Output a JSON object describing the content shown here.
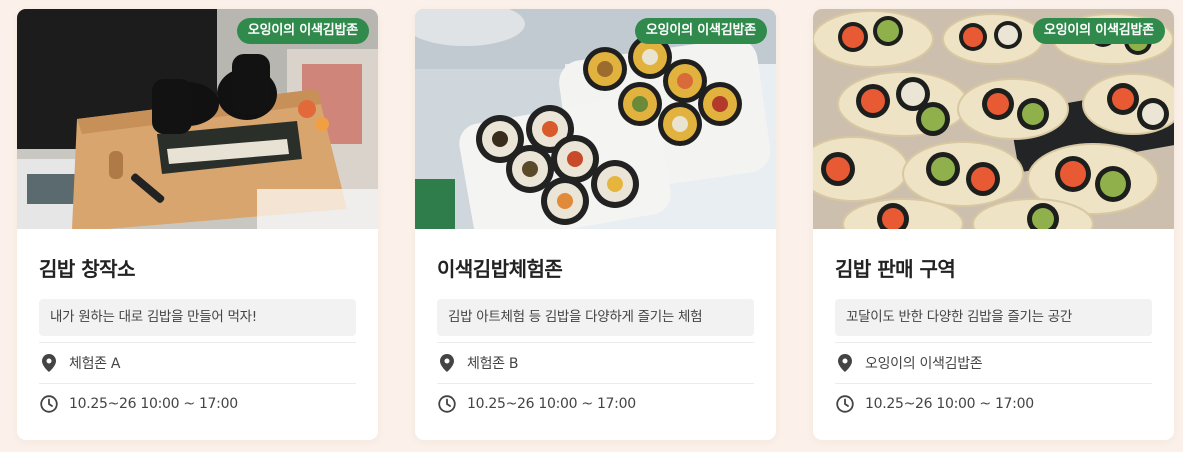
{
  "cards": [
    {
      "badge": "오잉이의 이색김밥존",
      "title": "김밥 창작소",
      "description": "내가 원하는 대로 김밥을 만들어 먹자!",
      "location": "체험존 A",
      "time": "10.25~26 10:00 ~ 17:00",
      "photo_icon": "kimbap-rolling-photo"
    },
    {
      "badge": "오잉이의 이색김밥존",
      "title": "이색김밥체험존",
      "description": "김밥 아트체험 등 김밥을 다양하게 즐기는 체험",
      "location": "체험존 B",
      "time": "10.25~26 10:00 ~ 17:00",
      "photo_icon": "kimbap-platter-photo"
    },
    {
      "badge": "오잉이의 이색김밥존",
      "title": "김밥 판매 구역",
      "description": "꼬달이도 반한 다양한 김밥을 즐기는 공간",
      "location": "오잉이의 이색김밥존",
      "time": "10.25~26 10:00 ~ 17:00",
      "photo_icon": "kimbap-plates-photo"
    }
  ],
  "colors": {
    "badge_bg": "#2f8a4c",
    "page_bg": "#fbf1ea",
    "icon": "#444444"
  },
  "icons": {
    "location": "map-pin-icon",
    "time": "clock-icon"
  }
}
